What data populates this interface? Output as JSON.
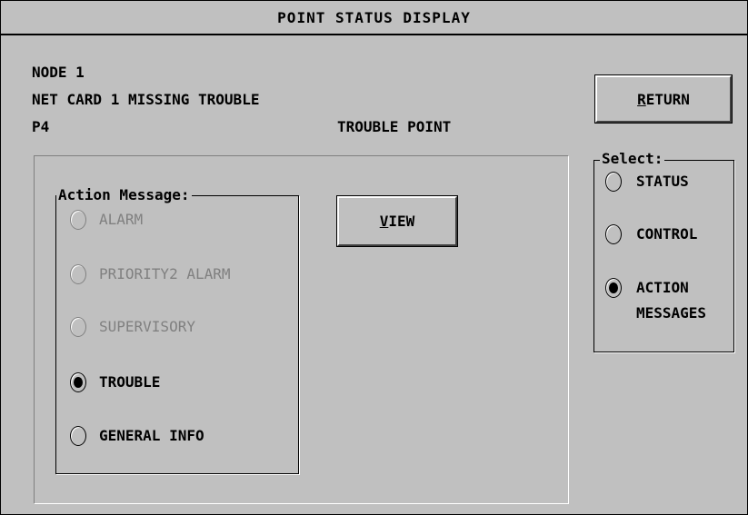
{
  "window": {
    "title": "POINT STATUS DISPLAY"
  },
  "info": {
    "node": "NODE 1",
    "description": "NET CARD 1 MISSING TROUBLE",
    "point": "P4",
    "point_type": "TROUBLE POINT"
  },
  "buttons": {
    "return_underlined": "R",
    "return_rest": "ETURN",
    "view_underlined": "V",
    "view_rest": "IEW"
  },
  "action_message": {
    "label": "Action Message:",
    "options": [
      {
        "label": "ALARM",
        "checked": false,
        "enabled": false
      },
      {
        "label": "PRIORITY2 ALARM",
        "checked": false,
        "enabled": false
      },
      {
        "label": "SUPERVISORY",
        "checked": false,
        "enabled": false
      },
      {
        "label": "TROUBLE",
        "checked": true,
        "enabled": true
      },
      {
        "label": "GENERAL INFO",
        "checked": false,
        "enabled": true
      }
    ]
  },
  "select": {
    "label": "Select:",
    "options": [
      {
        "label": "STATUS",
        "checked": false
      },
      {
        "label": "CONTROL",
        "checked": false
      },
      {
        "label_line1": "ACTION",
        "label_line2": "MESSAGES",
        "checked": true
      }
    ]
  }
}
